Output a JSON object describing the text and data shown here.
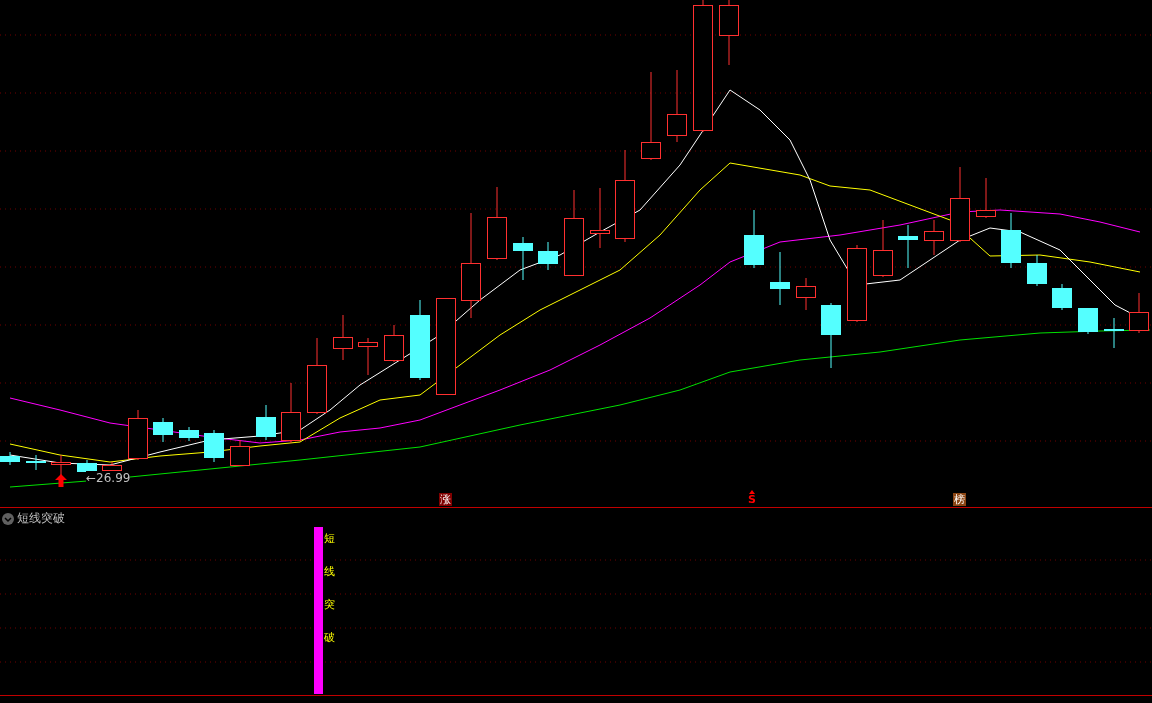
{
  "main_chart": {
    "low_label": "←26.99",
    "markers": [
      {
        "kind": "badge",
        "text": "涨",
        "color": "#800000"
      },
      {
        "kind": "arrow",
        "text": "S",
        "color": "#ff0000"
      },
      {
        "kind": "badge",
        "text": "榜",
        "color": "#8b4513"
      }
    ]
  },
  "indicator": {
    "title": "短线突破",
    "signal_text": "短线突破"
  }
}
